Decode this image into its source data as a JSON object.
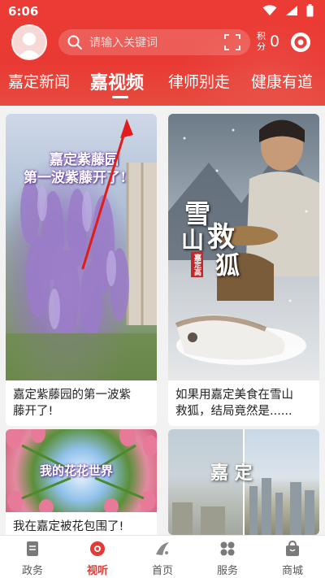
{
  "status_bar": {
    "time": "6:06"
  },
  "header": {
    "search_placeholder": "请输入关键词",
    "points_label": "积分",
    "points_count": "0"
  },
  "tabs": [
    {
      "label": "嘉定新闻"
    },
    {
      "label": "嘉视频",
      "active": true
    },
    {
      "label": "律师别走"
    },
    {
      "label": "健康有道"
    }
  ],
  "feed": {
    "cards": [
      {
        "overlay_line1": "嘉定紫藤园",
        "overlay_line2": "第一波紫藤开了!",
        "title_line1": "嘉定紫藤园的第一波紫",
        "title_line2": "藤开了!"
      },
      {
        "overlay_big1": "雪",
        "overlay_big2": "山",
        "overlay_big3": "救",
        "overlay_big4": "狐",
        "seal": "嘉定高",
        "title_line1": "如果用嘉定美食在雪山",
        "title_line2": "救狐，结局竟然是......"
      },
      {
        "overlay": "我的花花世界",
        "title_line1": "我在嘉定被花包围了!"
      },
      {
        "overlay": "嘉 定"
      }
    ]
  },
  "bottom_nav": [
    {
      "label": "政务",
      "icon": "document-icon"
    },
    {
      "label": "视听",
      "icon": "play-icon",
      "active": true
    },
    {
      "label": "首页",
      "icon": "home-logo-icon"
    },
    {
      "label": "服务",
      "icon": "grid-icon"
    },
    {
      "label": "商城",
      "icon": "bag-icon"
    }
  ],
  "colors": {
    "brand_red": "#e83a33",
    "active_nav": "#e53935"
  }
}
